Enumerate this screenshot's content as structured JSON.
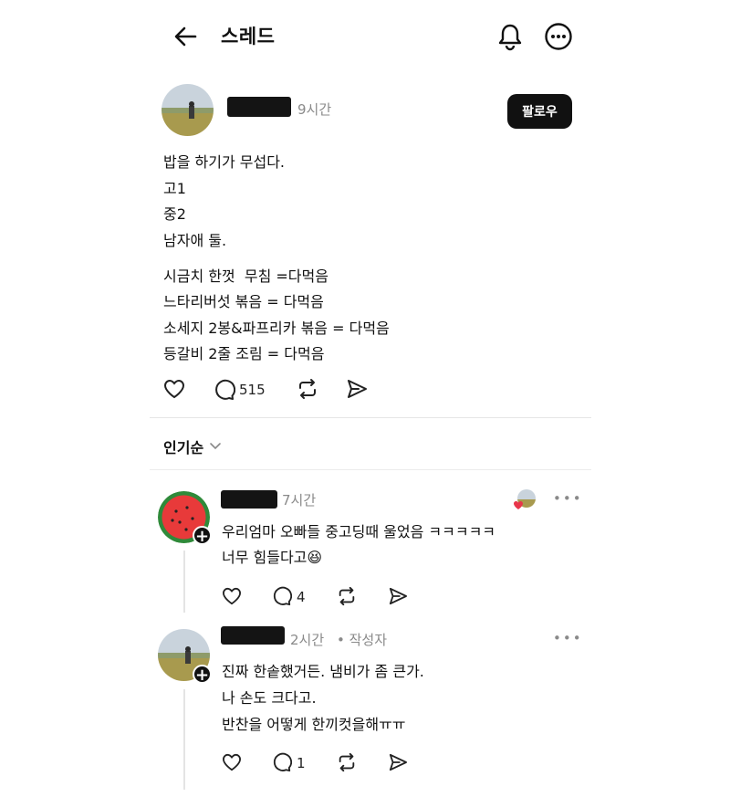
{
  "header": {
    "title": "스레드"
  },
  "post": {
    "time": "9시간",
    "follow_label": "팔로우",
    "lines": [
      "밥을 하기가 무섭다.",
      "고1",
      "중2",
      "남자애 둘."
    ],
    "menu_lines": [
      "시금치 한껏  무침 =다먹음",
      "느타리버섯 볶음 = 다먹음",
      "소세지 2봉&파프리카 볶음 = 다먹음",
      "등갈비 2줄 조림 = 다먹음"
    ],
    "comment_count": "515"
  },
  "sort": {
    "label": "인기순"
  },
  "comments": [
    {
      "time": "7시간",
      "author_tag": "",
      "lines": [
        "우리엄마 오빠들 중고딩때 울었음 ㅋㅋㅋㅋㅋ",
        "너무 힘들다고😆"
      ],
      "reply_count": "4"
    },
    {
      "time": "2시간",
      "author_tag": "• 작성자",
      "lines": [
        "진짜 한솥했거든. 냄비가 좀 큰가.",
        "나 손도 크다고.",
        "반찬을 어떻게 한끼컷을해ㅠㅠ"
      ],
      "reply_count": "1"
    }
  ],
  "icons": {
    "back": "arrow-left-icon",
    "bell": "bell-icon",
    "more": "more-circle-icon",
    "like": "heart-icon",
    "comment": "comment-bubble-icon",
    "repost": "repost-icon",
    "share": "send-icon",
    "chevron": "chevron-down-icon"
  }
}
